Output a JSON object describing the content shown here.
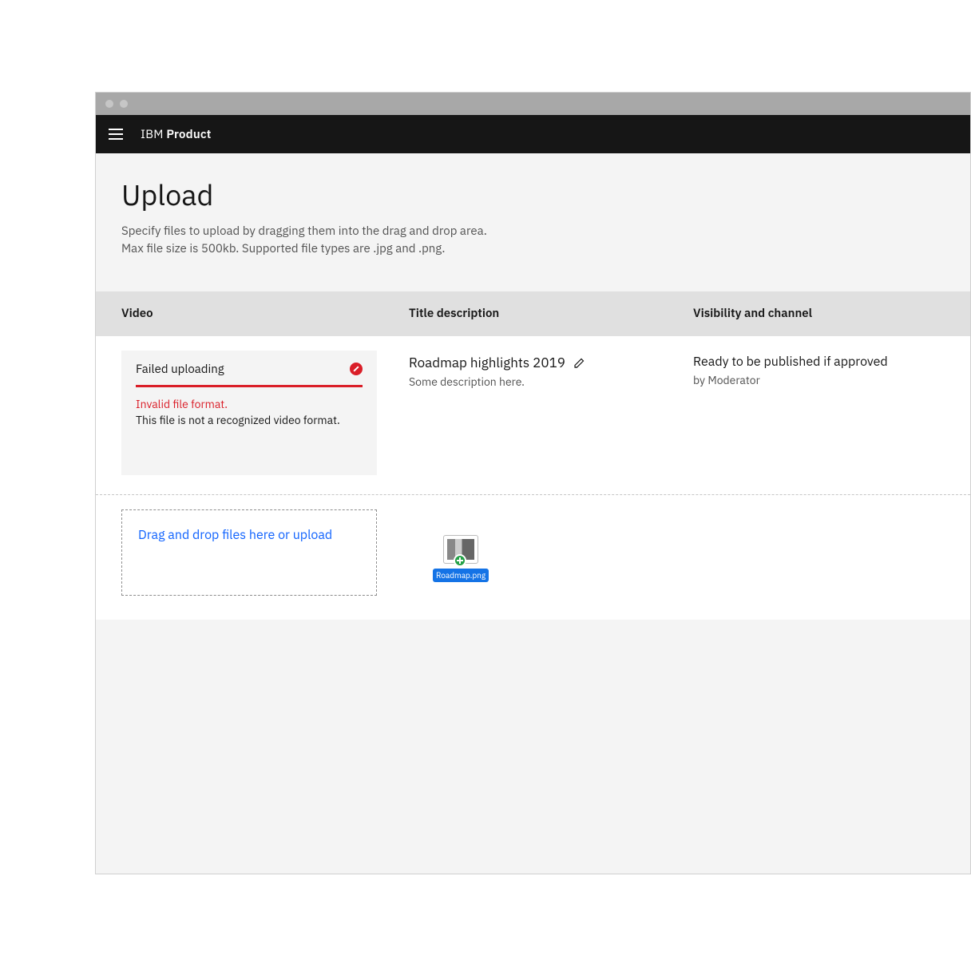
{
  "brand": {
    "prefix": "IBM",
    "name": "Product"
  },
  "page": {
    "title": "Upload",
    "desc_line1": "Specify files to upload by dragging them into the drag and drop area.",
    "desc_line2": "Max file size is 500kb. Supported file types are .jpg and .png."
  },
  "table": {
    "headers": {
      "video": "Video",
      "title": "Title description",
      "visibility": "Visibility and channel"
    },
    "row": {
      "upload_status": "Failed uploading",
      "error_reason": "Invalid file format.",
      "error_detail": "This file is not a recognized video format.",
      "title": "Roadmap highlights 2019",
      "description": "Some description here.",
      "visibility": "Ready to be published if approved",
      "visibility_by": "by Moderator"
    }
  },
  "dropzone": {
    "text": "Drag and drop files here or upload"
  },
  "drag_file": {
    "name": "Roadmap.png"
  }
}
